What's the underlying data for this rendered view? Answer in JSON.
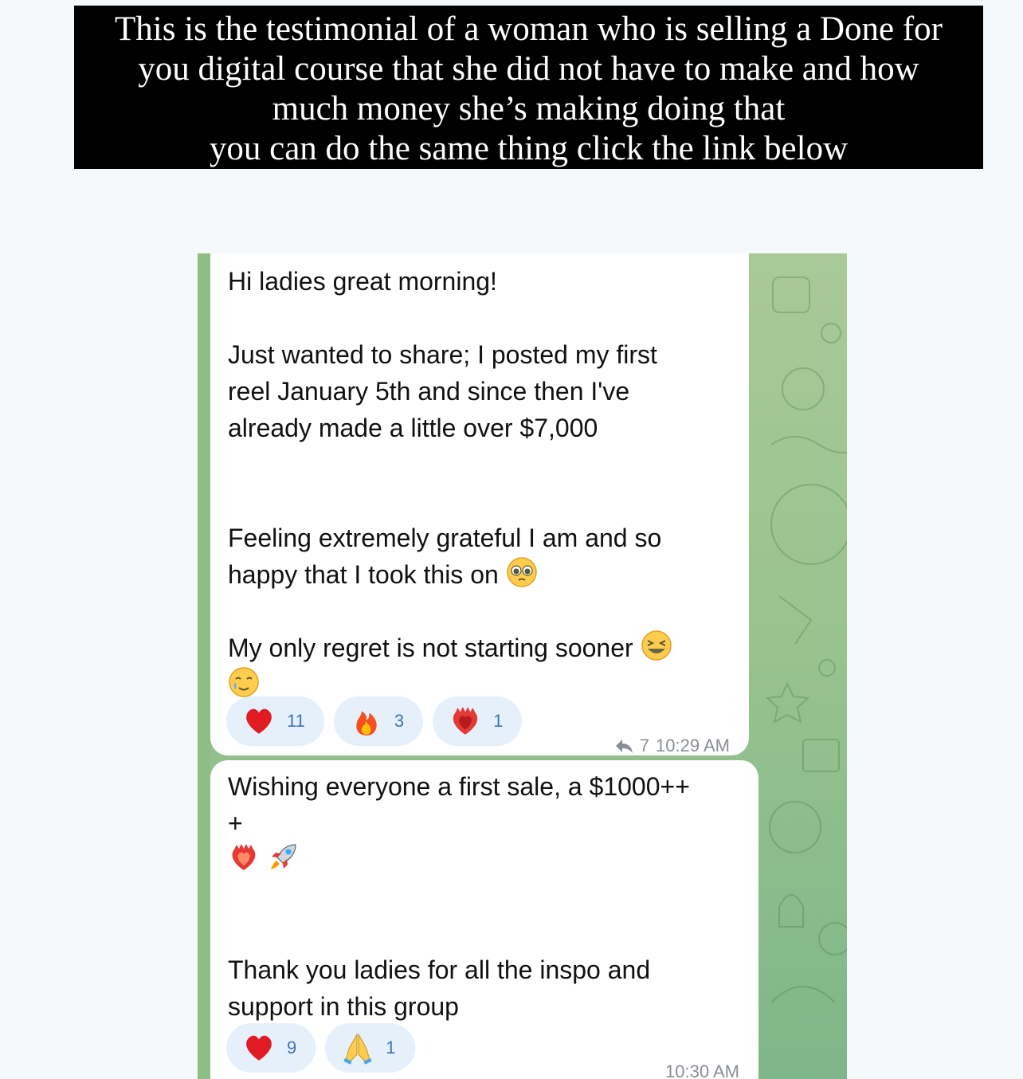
{
  "caption": {
    "line1": "This is the testimonial of a woman who is selling a Done for",
    "line2": "you digital course that she did not have to make and how",
    "line3": "much money she’s making doing that",
    "line4": "you can do the same thing click the link below"
  },
  "message1": {
    "greeting": "Hi ladies great morning!",
    "p1_line1": "Just wanted to share; I posted my first",
    "p1_line2": "reel January 5th and since then I've",
    "p1_line3": "already made a little over $7,000",
    "p2_line1": "Feeling extremely grateful I am and so",
    "p2_line2": "happy that I took this on",
    "p3_line1": "My only regret is not starting sooner",
    "reactions": [
      {
        "icon": "heart-icon",
        "count": "11"
      },
      {
        "icon": "fire-icon",
        "count": "3"
      },
      {
        "icon": "heart-on-fire-icon",
        "count": "1"
      }
    ],
    "forwards": "7",
    "time": "10:29 AM"
  },
  "message2": {
    "line1": "Wishing everyone a first sale, a $1000++",
    "line2": "+",
    "line3": "Thank you ladies for all the inspo and",
    "line4": "support in this group",
    "reactions": [
      {
        "icon": "heart-icon",
        "count": "9"
      },
      {
        "icon": "folded-hands-icon",
        "count": "1"
      }
    ],
    "time": "10:30 AM"
  },
  "colors": {
    "caption_bg": "#000000",
    "chat_bg": "#9cc48f",
    "reaction_bg": "#e6f0fb",
    "reaction_text": "#3d73b5"
  }
}
